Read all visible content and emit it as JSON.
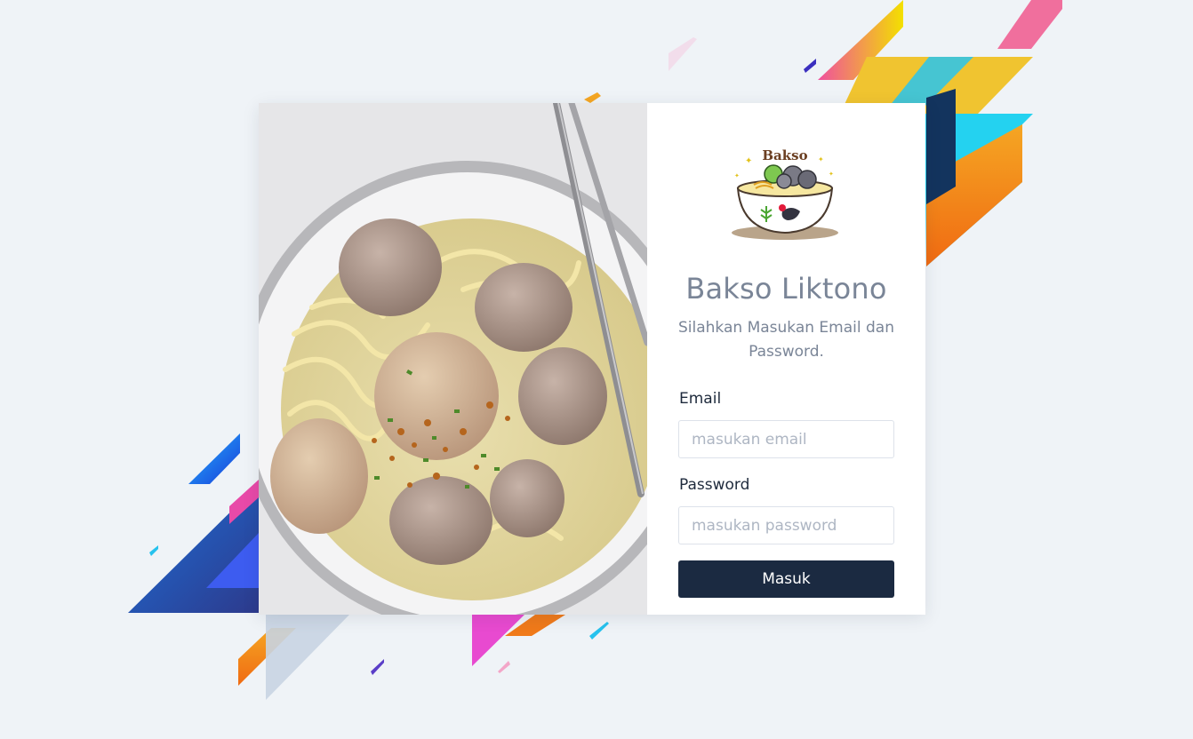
{
  "brand": {
    "title": "Bakso Liktono",
    "logo_text": "Bakso",
    "subtitle": "Silahkan Masukan Email dan Password."
  },
  "form": {
    "email_label": "Email",
    "email_placeholder": "masukan email",
    "email_value": "",
    "password_label": "Password",
    "password_placeholder": "masukan password",
    "password_value": "",
    "submit_label": "Masuk"
  },
  "colors": {
    "background": "#eff3f7",
    "button": "#1b2a41",
    "title_text": "#7a8597",
    "label_text": "#1e2a3c",
    "placeholder": "#aeb6c3"
  },
  "images": {
    "hero": "bakso-meatball-soup-photo",
    "logo": "bakso-bowl-logo"
  }
}
